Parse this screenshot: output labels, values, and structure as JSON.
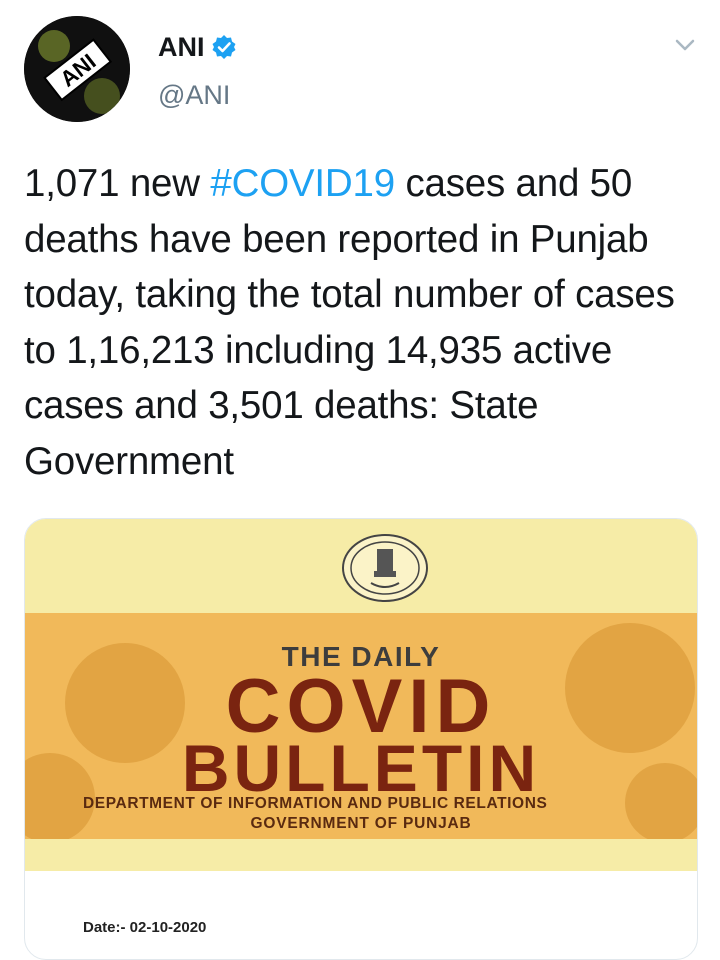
{
  "author": {
    "name": "ANI",
    "handle": "@ANI",
    "avatar_text": "ANI"
  },
  "icons": {
    "verified": "verified-badge-icon",
    "menu": "chevron-down-icon"
  },
  "colors": {
    "accent": "#1da1f2",
    "text": "#14171a",
    "muted": "#657786",
    "bulletin_yellow": "#f6eca7",
    "bulletin_orange": "#f1b95a",
    "bulletin_red": "#7a2410"
  },
  "tweet": {
    "text_before": "1,071 new ",
    "hashtag": "#COVID19",
    "text_after": " cases and 50 deaths have been reported in Punjab today, taking the total number of cases to 1,16,213 including 14,935 active cases and 3,501 deaths: State Government"
  },
  "media": {
    "heading_small": "THE DAILY",
    "heading_covid": "COVID",
    "heading_bulletin": "BULLETIN",
    "department": "DEPARTMENT OF INFORMATION AND PUBLIC RELATIONS",
    "government": "GOVERNMENT OF PUNJAB",
    "date_text": "Date:- 02-10-2020"
  }
}
